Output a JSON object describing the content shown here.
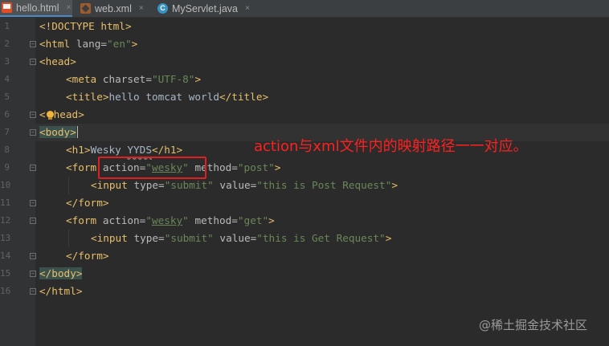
{
  "tabs": [
    {
      "label": "hello.html",
      "icon": "html-file-icon",
      "active": true
    },
    {
      "label": "web.xml",
      "icon": "xml-file-icon",
      "active": false
    },
    {
      "label": "MyServlet.java",
      "icon": "java-class-icon",
      "active": false
    }
  ],
  "close_glyph": "×",
  "line_numbers": [
    "1",
    "2",
    "3",
    "4",
    "5",
    "6",
    "7",
    "8",
    "9",
    "10",
    "11",
    "12",
    "13",
    "14",
    "15",
    "16"
  ],
  "code": {
    "l1": "<!DOCTYPE html>",
    "l2_open": "<html ",
    "l2_attr": "lang=",
    "l2_val": "\"en\"",
    "l2_close": ">",
    "l3": "<head>",
    "l4_open": "<meta ",
    "l4_attr": "charset=",
    "l4_val": "\"UTF-8\"",
    "l4_close": ">",
    "l5_open": "<title>",
    "l5_text": "hello tomcat world",
    "l5_close": "</title>",
    "l6_a": "<",
    "l6_b": "head>",
    "l7": "<body>",
    "l8_open": "<h1>",
    "l8_text1": "Wesky ",
    "l8_text2": "YYDS",
    "l8_close": "</h1>",
    "l9_open": "<form ",
    "l9_attr1": "action=",
    "l9_q1": "\"",
    "l9_action": "wesky",
    "l9_q2": "\"",
    "l9_attr2": " method=",
    "l9_val2": "\"post\"",
    "l9_close": ">",
    "l10_open": "<input ",
    "l10_attr1": "type=",
    "l10_val1": "\"submit\"",
    "l10_attr2": " value=",
    "l10_val2": "\"this is Post Request\"",
    "l10_close": ">",
    "l11": "</form>",
    "l12_open": "<form ",
    "l12_attr1": "action=",
    "l12_q1": "\"",
    "l12_action": "wesky",
    "l12_q2": "\"",
    "l12_attr2": " method=",
    "l12_val2": "\"get\"",
    "l12_close": ">",
    "l13_open": "<input ",
    "l13_attr1": "type=",
    "l13_val1": "\"submit\"",
    "l13_attr2": " value=",
    "l13_val2": "\"this is Get Request\"",
    "l13_close": ">",
    "l14": "</form>",
    "l15": "</body>",
    "l16": "</html>"
  },
  "annotation": "action与xml文件内的映射路径一一对应。",
  "watermark": "@稀土掘金技术社区",
  "colors": {
    "annotation": "#ff2020",
    "highlight_box": "#e02020",
    "tag": "#e8bf6a",
    "string": "#6a8759",
    "active_tab_underline": "#4a88c7"
  }
}
